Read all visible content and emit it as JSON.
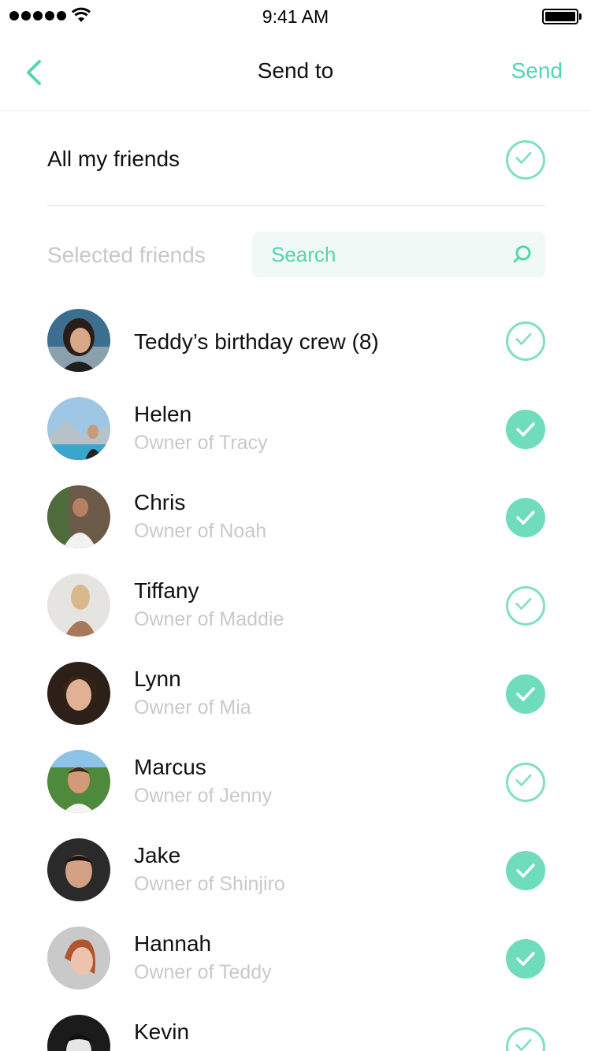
{
  "status": {
    "time": "9:41 AM"
  },
  "nav": {
    "title": "Send to",
    "send_label": "Send"
  },
  "all_friends": {
    "label": "All my friends",
    "checked": false
  },
  "selected": {
    "label": "Selected friends"
  },
  "search": {
    "placeholder": "Search"
  },
  "colors": {
    "accent": "#52d6b0",
    "check_fill": "#6fdcbc",
    "check_outline": "#7fe0c5",
    "muted": "#c9c9c9"
  },
  "friends": [
    {
      "name": "Teddy’s birthday crew (8)",
      "subtitle": "",
      "checked": false
    },
    {
      "name": "Helen",
      "subtitle": "Owner of Tracy",
      "checked": true
    },
    {
      "name": "Chris",
      "subtitle": "Owner of Noah",
      "checked": true
    },
    {
      "name": "Tiffany",
      "subtitle": "Owner of Maddie",
      "checked": false
    },
    {
      "name": "Lynn",
      "subtitle": "Owner of Mia",
      "checked": true
    },
    {
      "name": "Marcus",
      "subtitle": "Owner of Jenny",
      "checked": false
    },
    {
      "name": "Jake",
      "subtitle": "Owner of Shinjiro",
      "checked": true
    },
    {
      "name": "Hannah",
      "subtitle": "Owner of Teddy",
      "checked": true
    },
    {
      "name": "Kevin",
      "subtitle": "",
      "checked": false
    }
  ]
}
